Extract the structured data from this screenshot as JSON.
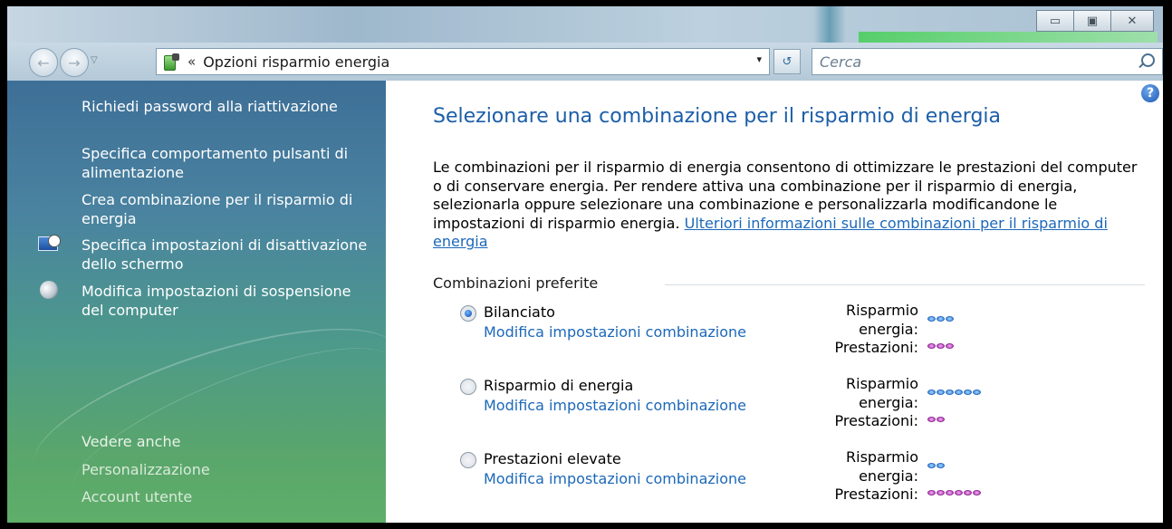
{
  "window": {
    "minimize_icon": "minimize-icon",
    "maximize_icon": "maximize-icon",
    "close_icon": "close-icon"
  },
  "address_bar": {
    "chevron": "«",
    "path": "Opzioni risparmio energia",
    "dropdown_glyph": "▾",
    "refresh_glyph": "↺"
  },
  "search": {
    "placeholder": "Cerca"
  },
  "sidebar": {
    "tasks": [
      {
        "label": "Richiedi password alla riattivazione"
      },
      {
        "label": "Specifica comportamento pulsanti di alimentazione"
      },
      {
        "label": "Crea combinazione per il risparmio di energia"
      },
      {
        "label": "Specifica impostazioni di disattivazione dello schermo",
        "icon": "monitor-clock-icon"
      },
      {
        "label": "Modifica impostazioni di sospensione del computer",
        "icon": "moon-icon"
      }
    ],
    "see_also_heading": "Vedere anche",
    "see_also": [
      {
        "label": "Personalizzazione"
      },
      {
        "label": "Account utente"
      }
    ]
  },
  "main": {
    "help_glyph": "?",
    "title": "Selezionare una combinazione per il risparmio di energia",
    "description": "Le combinazioni per il risparmio di energia consentono di ottimizzare le prestazioni del computer o di conservare energia. Per rendere attiva una combinazione per il risparmio di energia, selezionarla oppure selezionare una combinazione e personalizzarla modificandone le impostazioni di risparmio energia. ",
    "description_link": "Ulteriori informazioni sulle combinazioni per il risparmio di energia",
    "group_label": "Combinazioni preferite",
    "meter_label_saving": "Risparmio energia:",
    "meter_label_saving_line1": "Risparmio",
    "meter_label_saving_line2": "energia:",
    "meter_label_perf": "Prestazioni:",
    "plans": [
      {
        "name": "Bilanciato",
        "selected": true,
        "edit_link": "Modifica impostazioni combinazione",
        "saving_level": 3,
        "performance_level": 3
      },
      {
        "name": "Risparmio di energia",
        "selected": false,
        "edit_link": "Modifica impostazioni combinazione",
        "saving_level": 6,
        "performance_level": 2
      },
      {
        "name": "Prestazioni elevate",
        "selected": false,
        "edit_link": "Modifica impostazioni combinazione",
        "saving_level": 2,
        "performance_level": 6
      }
    ]
  },
  "colors": {
    "link": "#1c68b8",
    "title": "#1c5ea8",
    "saving_dots": "#3a86e0",
    "performance_dots": "#b340b8"
  }
}
